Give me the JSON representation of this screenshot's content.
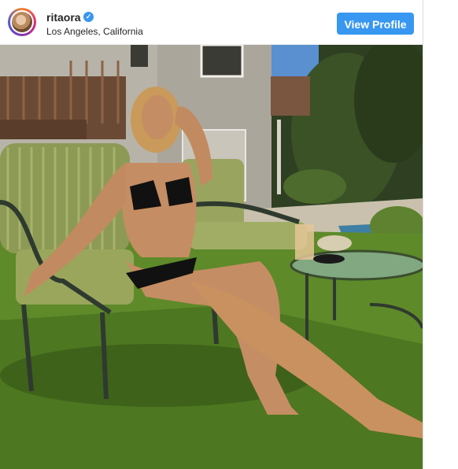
{
  "post": {
    "username": "ritaora",
    "verified_icon": "verified-badge-icon",
    "location": "Los Angeles, California",
    "view_profile_label": "View Profile"
  },
  "colors": {
    "accent": "#3897f0",
    "text": "#262626",
    "border": "#dbdbdb"
  }
}
